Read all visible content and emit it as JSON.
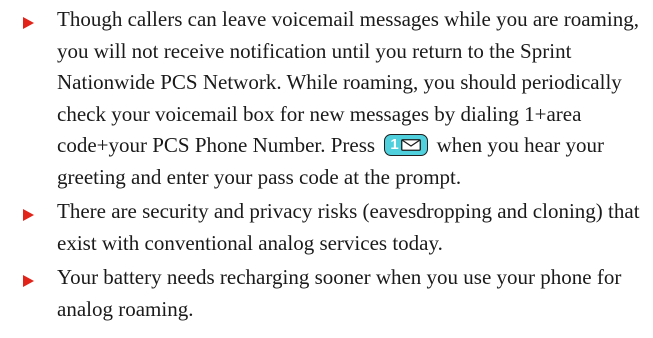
{
  "bullets": [
    {
      "text_before": "Though callers can leave voicemail messages while you are roaming, you will not receive notification until you return to the Sprint Nationwide PCS Network. While roaming, you should periodically check your voicemail box for new messages by dialing 1+area code+your PCS Phone Number. Press",
      "key": {
        "digit": "1",
        "icon": "envelope-icon",
        "color": "#4fd0dc"
      },
      "text_after": "when you hear your greeting and enter your pass code at the prompt."
    },
    {
      "text": "There are security and privacy risks (eavesdropping and cloning) that exist with conventional analog services today."
    },
    {
      "text": "Your battery needs recharging sooner when you use your phone for analog roaming."
    }
  ],
  "colors": {
    "bullet_marker": "#e2231a",
    "text": "#1a1a1a",
    "key_badge": "#4fd0dc"
  }
}
